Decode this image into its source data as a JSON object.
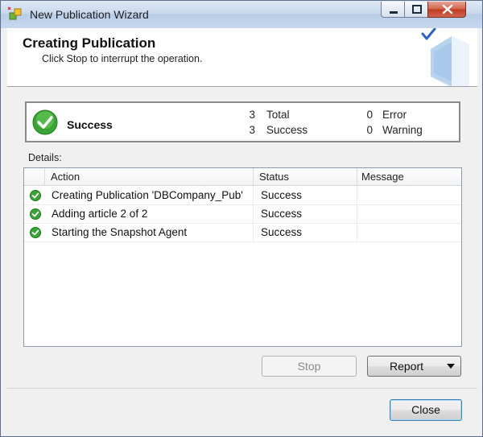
{
  "window": {
    "title": "New Publication Wizard"
  },
  "header": {
    "title": "Creating Publication",
    "subtitle": "Click Stop to interrupt the operation."
  },
  "summary": {
    "status": "Success",
    "total_count": "3",
    "total_label": "Total",
    "success_count": "3",
    "success_label": "Success",
    "error_count": "0",
    "error_label": "Error",
    "warning_count": "0",
    "warning_label": "Warning"
  },
  "details": {
    "label": "Details:",
    "columns": {
      "action": "Action",
      "status": "Status",
      "message": "Message"
    },
    "rows": [
      {
        "action": "Creating Publication 'DBCompany_Pub'",
        "status": "Success",
        "message": ""
      },
      {
        "action": "Adding article 2 of 2",
        "status": "Success",
        "message": ""
      },
      {
        "action": "Starting the Snapshot Agent",
        "status": "Success",
        "message": ""
      }
    ]
  },
  "buttons": {
    "stop": "Stop",
    "report": "Report",
    "close": "Close"
  },
  "icons": {
    "app": "wizard-app-icon",
    "success": "green-checkmark-icon",
    "header_art": "book-checkmark-icon",
    "report_dropdown": "triangle-down-icon"
  },
  "colors": {
    "success_green": "#3aa335",
    "title_bar": "#c9d9ee",
    "close_red": "#c0391f"
  }
}
